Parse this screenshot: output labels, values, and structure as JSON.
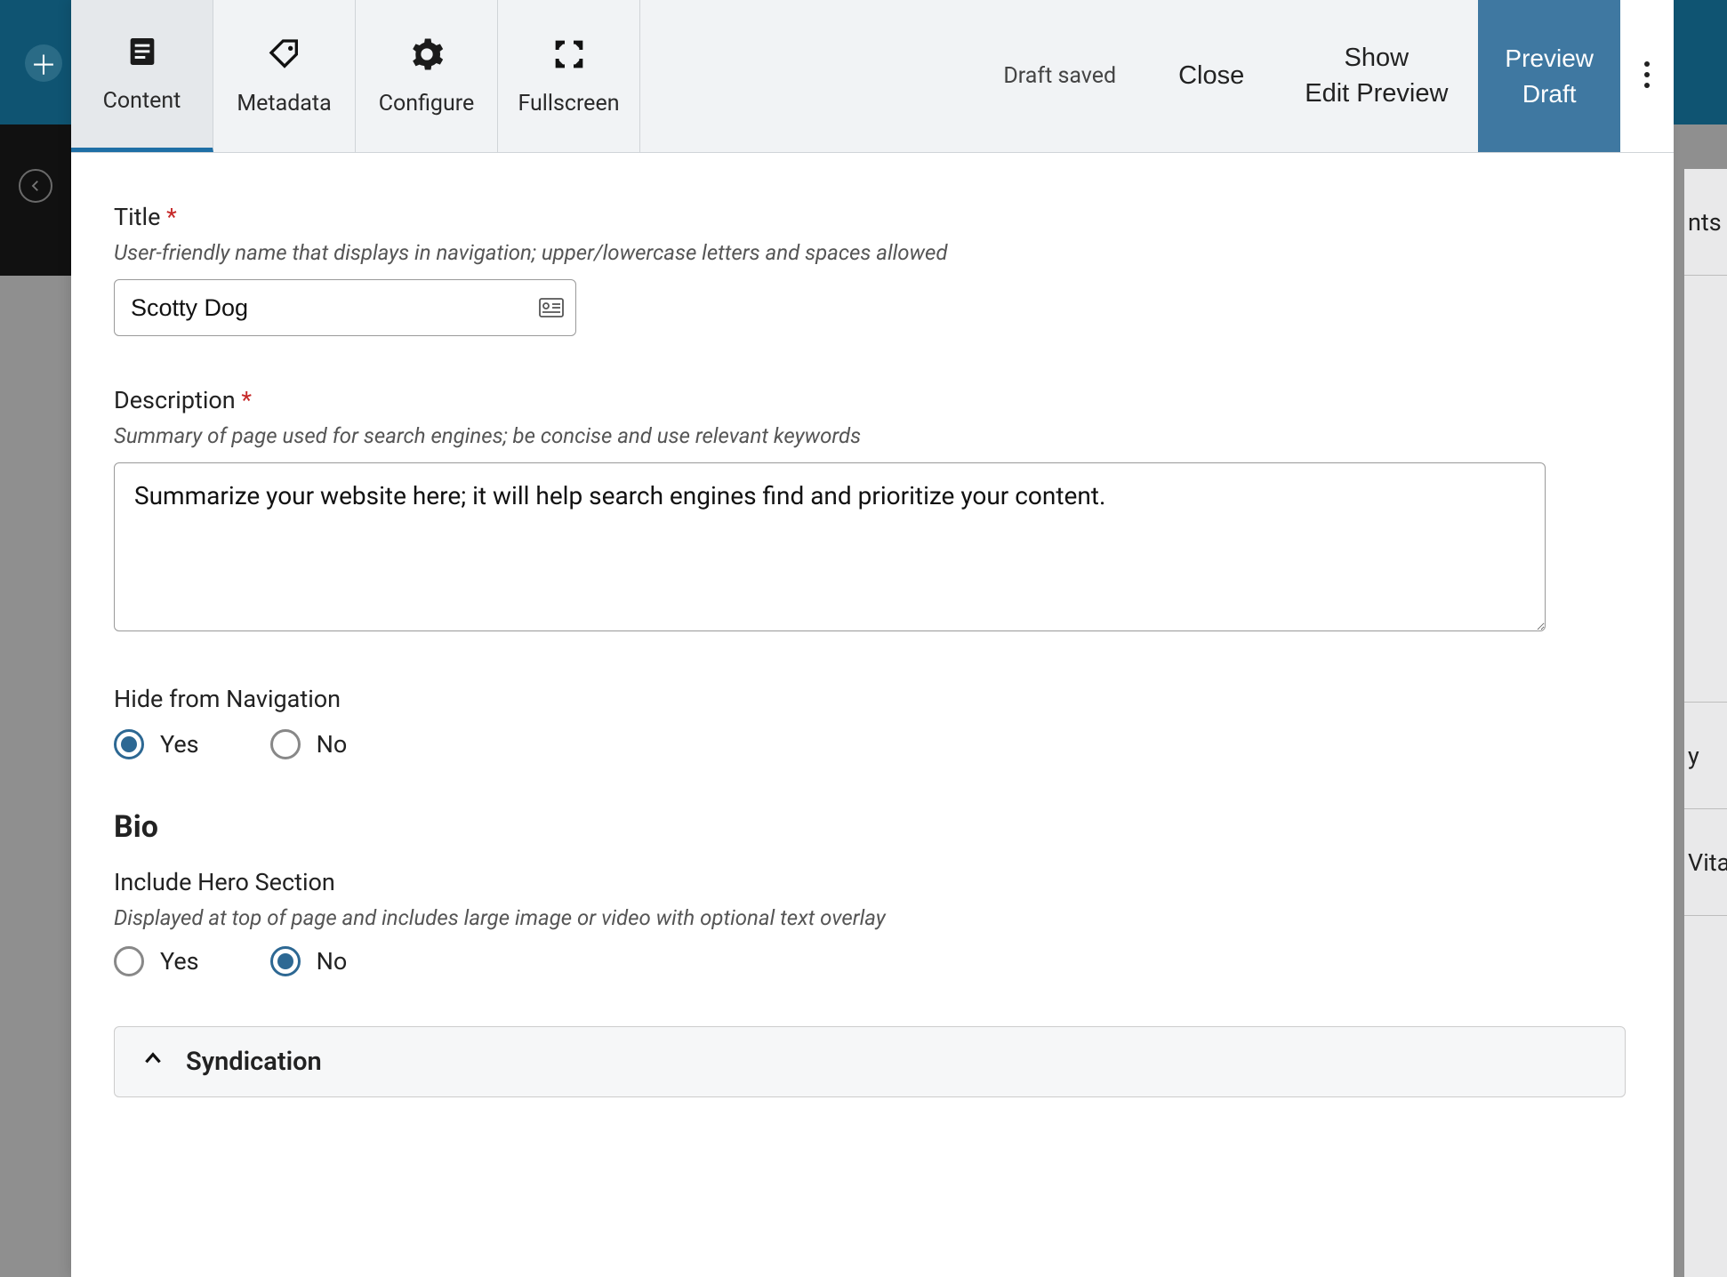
{
  "toolbar": {
    "tabs": {
      "content": "Content",
      "metadata": "Metadata",
      "configure": "Configure",
      "fullscreen": "Fullscreen"
    },
    "status": "Draft saved",
    "close": "Close",
    "show_edit_preview_line1": "Show",
    "show_edit_preview_line2": "Edit Preview",
    "preview_draft_line1": "Preview",
    "preview_draft_line2": "Draft"
  },
  "form": {
    "title": {
      "label": "Title",
      "hint": "User-friendly name that displays in navigation; upper/lowercase letters and spaces allowed",
      "value": "Scotty Dog"
    },
    "description": {
      "label": "Description",
      "hint": "Summary of page used for search engines; be concise and use relevant keywords",
      "value": "Summarize your website here; it will help search engines find and prioritize your content."
    },
    "hide_nav": {
      "label": "Hide from Navigation",
      "yes": "Yes",
      "no": "No",
      "selected": "yes"
    },
    "bio_heading": "Bio",
    "hero": {
      "label": "Include Hero Section",
      "hint": "Displayed at top of page and includes large image or video with optional text overlay",
      "yes": "Yes",
      "no": "No",
      "selected": "no"
    },
    "syndication": {
      "label": "Syndication"
    }
  },
  "background": {
    "right_text_1": "nts",
    "right_text_2": "y",
    "right_text_3": "Vita"
  }
}
